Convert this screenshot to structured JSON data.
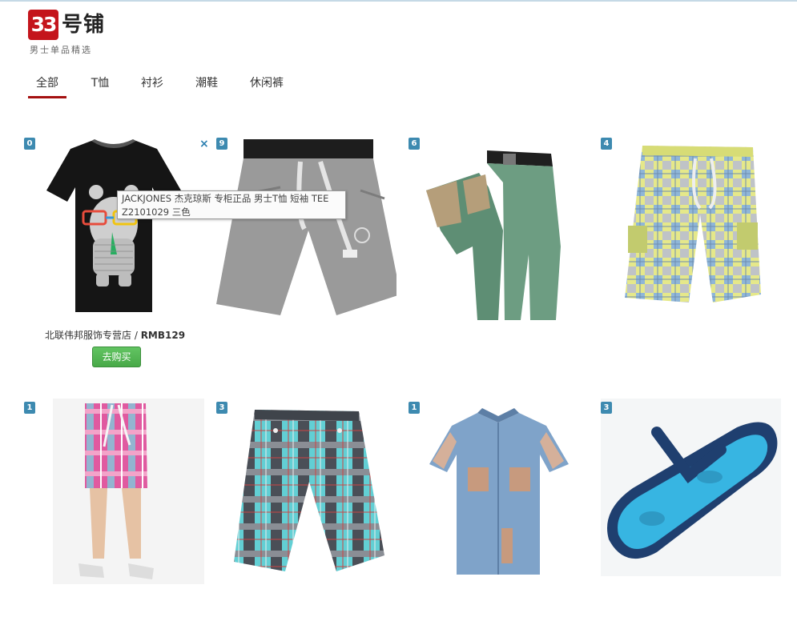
{
  "brand": {
    "mark": "33",
    "name": "号铺",
    "tagline": "男士单品精选"
  },
  "nav": {
    "tabs": [
      {
        "label": "全部",
        "active": true
      },
      {
        "label": "T恤",
        "active": false
      },
      {
        "label": "衬衫",
        "active": false
      },
      {
        "label": "潮鞋",
        "active": false
      },
      {
        "label": "休闲裤",
        "active": false
      }
    ]
  },
  "products": [
    {
      "badge": "0",
      "item": "black-rhino-tshirt"
    },
    {
      "badge": "9",
      "item": "grey-sweat-shorts"
    },
    {
      "badge": "6",
      "item": "green-chinos"
    },
    {
      "badge": "4",
      "item": "yellow-plaid-cargo-shorts"
    },
    {
      "badge": "1",
      "item": "pink-plaid-board-shorts"
    },
    {
      "badge": "3",
      "item": "teal-plaid-shorts"
    },
    {
      "badge": "1",
      "item": "denim-patchwork-shirt"
    },
    {
      "badge": "3",
      "item": "blue-flip-flop"
    }
  ],
  "hover_card": {
    "shop": "北联伟邦服饰专营店",
    "separator": " / ",
    "price": "RMB129",
    "buy_label": "去购买",
    "close_symbol": "×",
    "tooltip": "JACKJONES 杰克琼斯 专柜正品  男士T恤 短袖 TEE Z2101029 三色"
  },
  "colors": {
    "brand_red": "#c4151c",
    "active_tab": "#a41010",
    "badge_blue": "#3d8ab0",
    "buy_green": "#5cb85c"
  }
}
